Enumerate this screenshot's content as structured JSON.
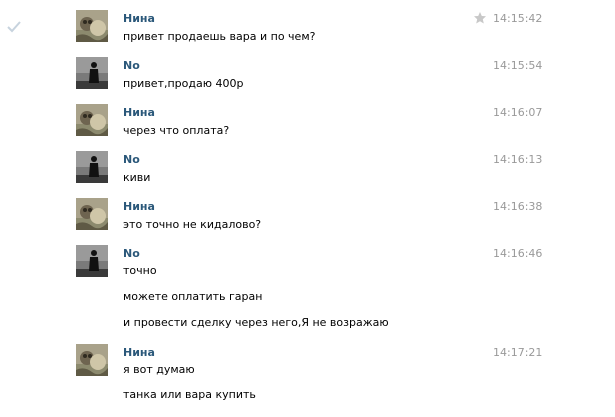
{
  "colors": {
    "author": "#2b587a",
    "time": "#999999",
    "text": "#000000",
    "check": "#c7d3de",
    "star": "#c8c8c8"
  },
  "messages": [
    {
      "author": "Нина",
      "avatar": "nina-avatar",
      "time": "14:15:42",
      "lines": [
        "привет продаешь вара и по чем?"
      ],
      "read_check": true,
      "star": true
    },
    {
      "author": "No",
      "avatar": "no-avatar",
      "time": "14:15:54",
      "lines": [
        "привет,продаю 400р"
      ]
    },
    {
      "author": "Нина",
      "avatar": "nina-avatar",
      "time": "14:16:07",
      "lines": [
        "через что оплата?"
      ]
    },
    {
      "author": "No",
      "avatar": "no-avatar",
      "time": "14:16:13",
      "lines": [
        "киви"
      ]
    },
    {
      "author": "Нина",
      "avatar": "nina-avatar",
      "time": "14:16:38",
      "lines": [
        "это точно не кидалово?"
      ]
    },
    {
      "author": "No",
      "avatar": "no-avatar",
      "time": "14:16:46",
      "lines": [
        "точно",
        "можете оплатить гаран",
        "и провести сделку через него,Я не возражаю"
      ]
    },
    {
      "author": "Нина",
      "avatar": "nina-avatar",
      "time": "14:17:21",
      "lines": [
        "я вот думаю",
        "танка или вара купить"
      ]
    }
  ]
}
